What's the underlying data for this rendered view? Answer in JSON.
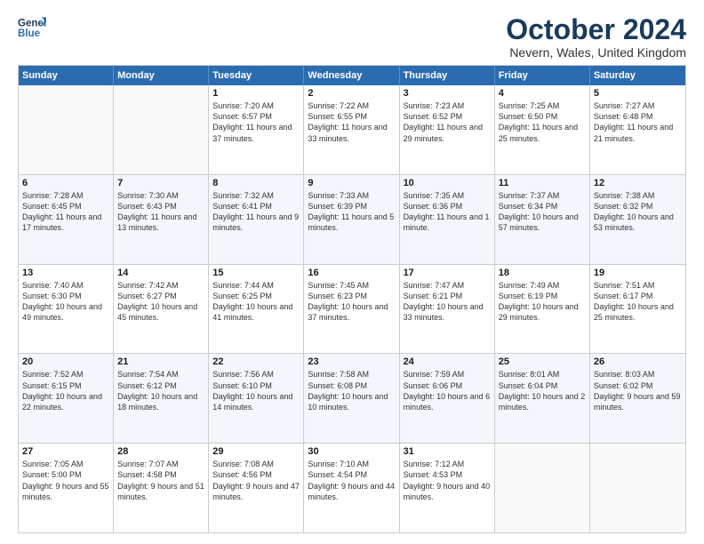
{
  "logo": {
    "line1": "General",
    "line2": "Blue"
  },
  "title": "October 2024",
  "subtitle": "Nevern, Wales, United Kingdom",
  "weekdays": [
    "Sunday",
    "Monday",
    "Tuesday",
    "Wednesday",
    "Thursday",
    "Friday",
    "Saturday"
  ],
  "weeks": [
    [
      {
        "day": "",
        "info": ""
      },
      {
        "day": "",
        "info": ""
      },
      {
        "day": "1",
        "info": "Sunrise: 7:20 AM\nSunset: 6:57 PM\nDaylight: 11 hours and 37 minutes."
      },
      {
        "day": "2",
        "info": "Sunrise: 7:22 AM\nSunset: 6:55 PM\nDaylight: 11 hours and 33 minutes."
      },
      {
        "day": "3",
        "info": "Sunrise: 7:23 AM\nSunset: 6:52 PM\nDaylight: 11 hours and 29 minutes."
      },
      {
        "day": "4",
        "info": "Sunrise: 7:25 AM\nSunset: 6:50 PM\nDaylight: 11 hours and 25 minutes."
      },
      {
        "day": "5",
        "info": "Sunrise: 7:27 AM\nSunset: 6:48 PM\nDaylight: 11 hours and 21 minutes."
      }
    ],
    [
      {
        "day": "6",
        "info": "Sunrise: 7:28 AM\nSunset: 6:45 PM\nDaylight: 11 hours and 17 minutes."
      },
      {
        "day": "7",
        "info": "Sunrise: 7:30 AM\nSunset: 6:43 PM\nDaylight: 11 hours and 13 minutes."
      },
      {
        "day": "8",
        "info": "Sunrise: 7:32 AM\nSunset: 6:41 PM\nDaylight: 11 hours and 9 minutes."
      },
      {
        "day": "9",
        "info": "Sunrise: 7:33 AM\nSunset: 6:39 PM\nDaylight: 11 hours and 5 minutes."
      },
      {
        "day": "10",
        "info": "Sunrise: 7:35 AM\nSunset: 6:36 PM\nDaylight: 11 hours and 1 minute."
      },
      {
        "day": "11",
        "info": "Sunrise: 7:37 AM\nSunset: 6:34 PM\nDaylight: 10 hours and 57 minutes."
      },
      {
        "day": "12",
        "info": "Sunrise: 7:38 AM\nSunset: 6:32 PM\nDaylight: 10 hours and 53 minutes."
      }
    ],
    [
      {
        "day": "13",
        "info": "Sunrise: 7:40 AM\nSunset: 6:30 PM\nDaylight: 10 hours and 49 minutes."
      },
      {
        "day": "14",
        "info": "Sunrise: 7:42 AM\nSunset: 6:27 PM\nDaylight: 10 hours and 45 minutes."
      },
      {
        "day": "15",
        "info": "Sunrise: 7:44 AM\nSunset: 6:25 PM\nDaylight: 10 hours and 41 minutes."
      },
      {
        "day": "16",
        "info": "Sunrise: 7:45 AM\nSunset: 6:23 PM\nDaylight: 10 hours and 37 minutes."
      },
      {
        "day": "17",
        "info": "Sunrise: 7:47 AM\nSunset: 6:21 PM\nDaylight: 10 hours and 33 minutes."
      },
      {
        "day": "18",
        "info": "Sunrise: 7:49 AM\nSunset: 6:19 PM\nDaylight: 10 hours and 29 minutes."
      },
      {
        "day": "19",
        "info": "Sunrise: 7:51 AM\nSunset: 6:17 PM\nDaylight: 10 hours and 25 minutes."
      }
    ],
    [
      {
        "day": "20",
        "info": "Sunrise: 7:52 AM\nSunset: 6:15 PM\nDaylight: 10 hours and 22 minutes."
      },
      {
        "day": "21",
        "info": "Sunrise: 7:54 AM\nSunset: 6:12 PM\nDaylight: 10 hours and 18 minutes."
      },
      {
        "day": "22",
        "info": "Sunrise: 7:56 AM\nSunset: 6:10 PM\nDaylight: 10 hours and 14 minutes."
      },
      {
        "day": "23",
        "info": "Sunrise: 7:58 AM\nSunset: 6:08 PM\nDaylight: 10 hours and 10 minutes."
      },
      {
        "day": "24",
        "info": "Sunrise: 7:59 AM\nSunset: 6:06 PM\nDaylight: 10 hours and 6 minutes."
      },
      {
        "day": "25",
        "info": "Sunrise: 8:01 AM\nSunset: 6:04 PM\nDaylight: 10 hours and 2 minutes."
      },
      {
        "day": "26",
        "info": "Sunrise: 8:03 AM\nSunset: 6:02 PM\nDaylight: 9 hours and 59 minutes."
      }
    ],
    [
      {
        "day": "27",
        "info": "Sunrise: 7:05 AM\nSunset: 5:00 PM\nDaylight: 9 hours and 55 minutes."
      },
      {
        "day": "28",
        "info": "Sunrise: 7:07 AM\nSunset: 4:58 PM\nDaylight: 9 hours and 51 minutes."
      },
      {
        "day": "29",
        "info": "Sunrise: 7:08 AM\nSunset: 4:56 PM\nDaylight: 9 hours and 47 minutes."
      },
      {
        "day": "30",
        "info": "Sunrise: 7:10 AM\nSunset: 4:54 PM\nDaylight: 9 hours and 44 minutes."
      },
      {
        "day": "31",
        "info": "Sunrise: 7:12 AM\nSunset: 4:53 PM\nDaylight: 9 hours and 40 minutes."
      },
      {
        "day": "",
        "info": ""
      },
      {
        "day": "",
        "info": ""
      }
    ]
  ]
}
